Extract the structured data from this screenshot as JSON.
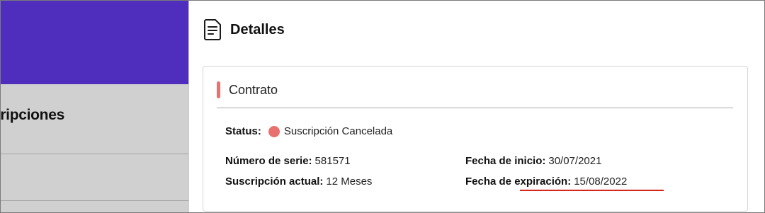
{
  "backdrop": {
    "title": "uscripciones",
    "header_color": "#4f2dbd"
  },
  "drawer": {
    "icon": "document-icon",
    "title": "Detalles"
  },
  "contract": {
    "title": "Contrato",
    "accent_color": "#e8716f",
    "status_label": "Status:",
    "status_value": "Suscripción Cancelada",
    "status_color": "#e8716f",
    "serial_label": "Número de serie:",
    "serial_value": "581571",
    "current_label": "Suscripción actual:",
    "current_value": "12 Meses",
    "start_label": "Fecha de inicio:",
    "start_value": "30/07/2021",
    "expiry_label": "Fecha de expiración:",
    "expiry_value": "15/08/2022",
    "highlight_color": "#d8261c"
  }
}
